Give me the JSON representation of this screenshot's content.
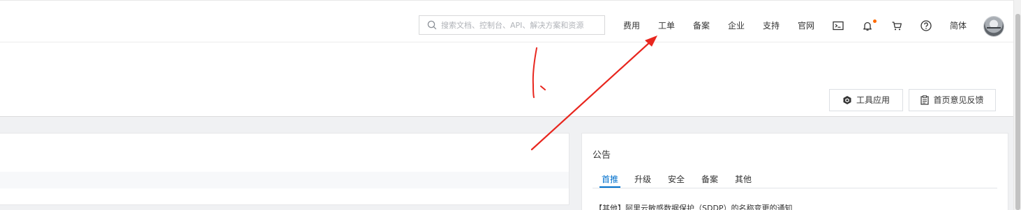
{
  "search": {
    "placeholder": "搜索文档、控制台、API、解决方案和资源"
  },
  "nav": {
    "fees": "费用",
    "tickets": "工单",
    "filing": "备案",
    "enterprise": "企业",
    "support": "支持",
    "official_site": "官网",
    "language": "简体"
  },
  "icons": {
    "search": "search-icon",
    "terminal": "terminal-icon",
    "notifications": "bell-icon",
    "cart": "cart-icon",
    "help": "help-icon",
    "tools": "cube-icon",
    "feedback": "clipboard-icon"
  },
  "header_buttons": {
    "tools_label": "工具应用",
    "feedback_label": "首页意见反馈"
  },
  "notice": {
    "title": "公告",
    "tabs": [
      "首推",
      "升级",
      "安全",
      "备案",
      "其他"
    ],
    "active_tab": "首推",
    "items": [
      "【其他】阿里云敏感数据保护（SDDP）的名称变更的通知"
    ]
  },
  "annotation": {
    "label": "1、"
  },
  "colors": {
    "accent": "#0070cc",
    "notification_dot": "#ff6a00",
    "annotation": "#e8261e",
    "content_bg": "#f0f1f3"
  }
}
